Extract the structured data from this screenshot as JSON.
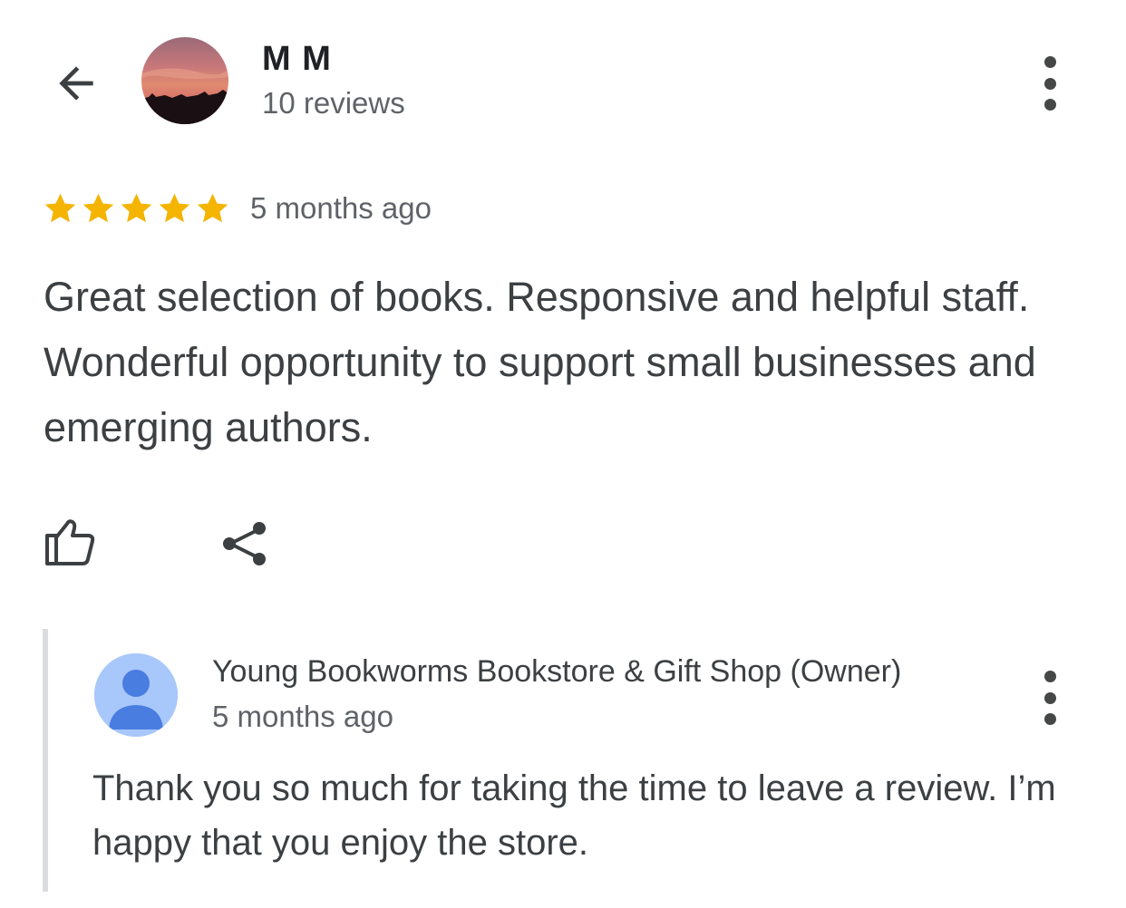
{
  "header": {
    "back_icon": "arrow-back-icon",
    "author_name": "M M",
    "review_count": "10 reviews",
    "menu_icon": "more-vert-icon"
  },
  "review": {
    "rating": 5,
    "rating_max": 5,
    "star_color": "#F4B400",
    "time": "5 months ago",
    "text": "Great selection of books. Responsive and helpful staff. Wonderful opportunity to support small businesses and emerging authors."
  },
  "actions": {
    "like_icon": "thumb-up-icon",
    "share_icon": "share-icon"
  },
  "owner_reply": {
    "name": "Young Bookworms Bookstore & Gift Shop (Owner)",
    "time": "5 months ago",
    "text": "Thank you so much for taking the time to leave a review. I’m happy that you enjoy the store.",
    "avatar_color": "#A8C7FA",
    "avatar_icon": "person-icon",
    "menu_icon": "more-vert-icon"
  }
}
